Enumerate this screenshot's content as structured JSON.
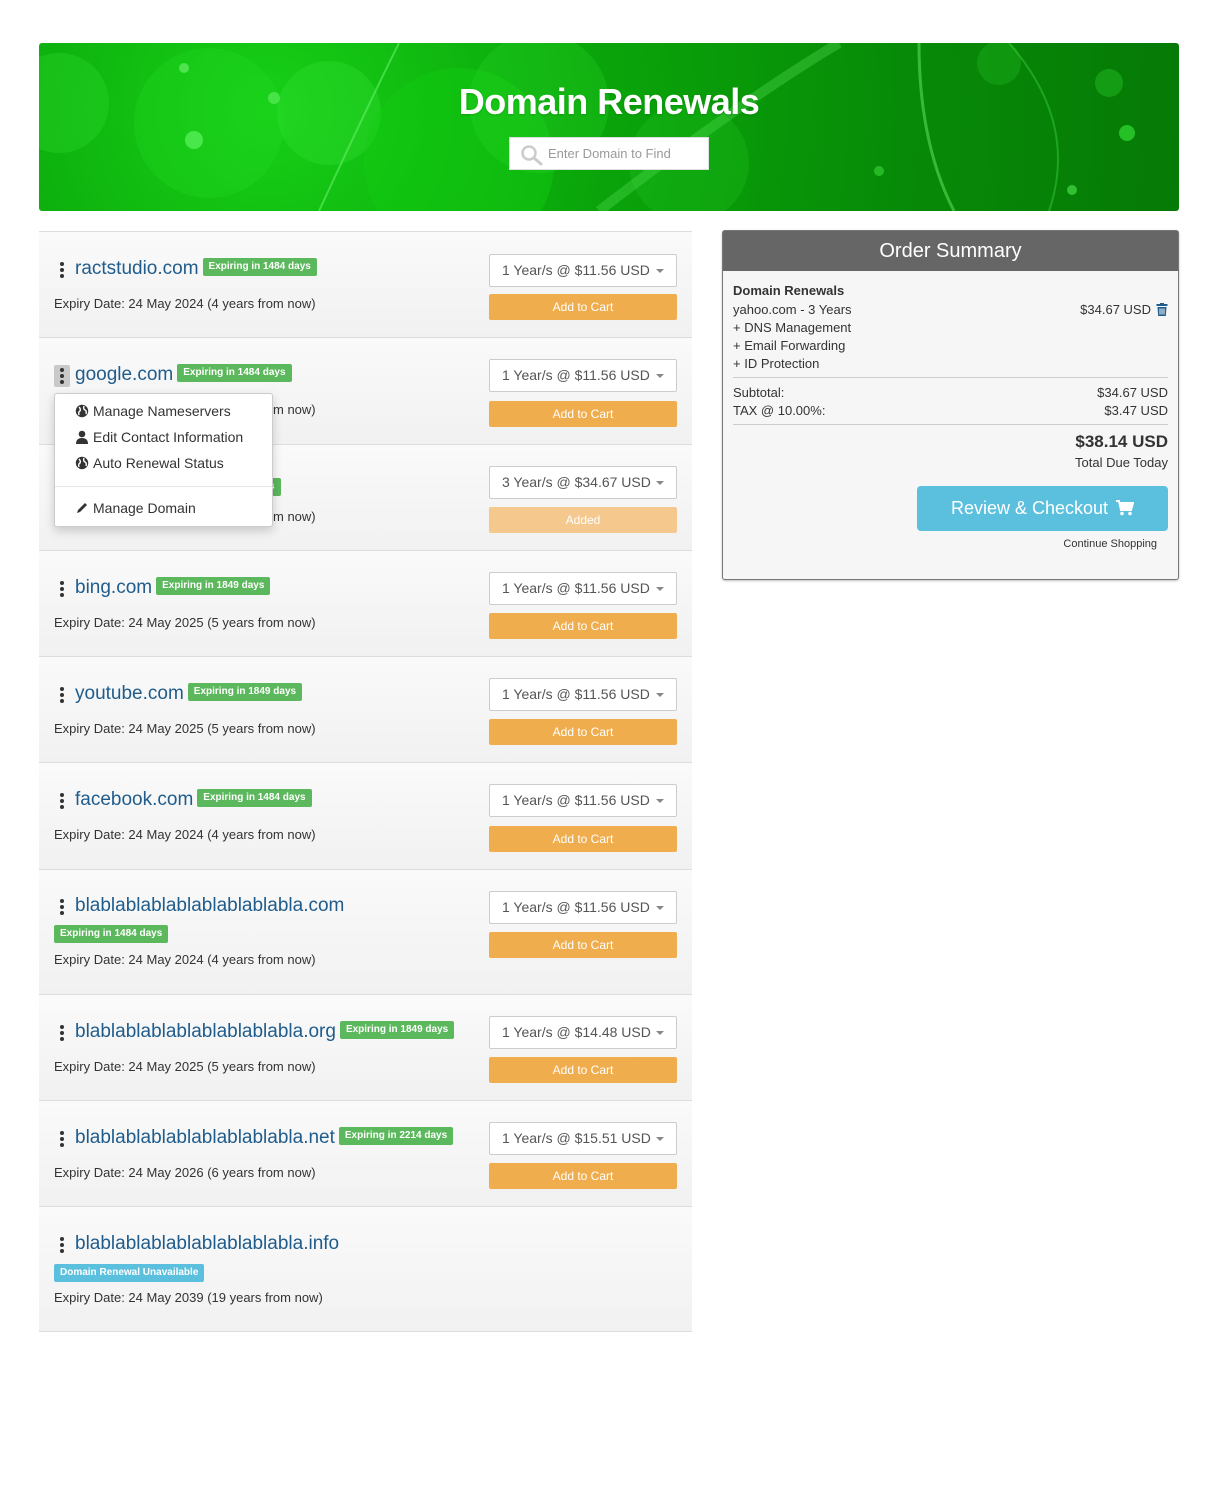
{
  "banner": {
    "title": "Domain Renewals",
    "search_placeholder": "Enter Domain to Find"
  },
  "domains": [
    {
      "name": "ractstudio.com",
      "badge": "Expiring in 1484 days",
      "expiry": "Expiry Date: 24 May 2024 (4 years from now)",
      "period": "1 Year/s @ $11.56 USD",
      "action": "Add to Cart"
    },
    {
      "name": "google.com",
      "badge": "Expiring in 1484 days",
      "expiry": "m now)",
      "period": "1 Year/s @ $11.56 USD",
      "action": "Add to Cart"
    },
    {
      "badge": "s",
      "expiry": "m now)",
      "period": "3 Year/s @ $34.67 USD",
      "action": "Added"
    },
    {
      "name": "bing.com",
      "badge": "Expiring in 1849 days",
      "expiry": "Expiry Date: 24 May 2025 (5 years from now)",
      "period": "1 Year/s @ $11.56 USD",
      "action": "Add to Cart"
    },
    {
      "name": "youtube.com",
      "badge": "Expiring in 1849 days",
      "expiry": "Expiry Date: 24 May 2025 (5 years from now)",
      "period": "1 Year/s @ $11.56 USD",
      "action": "Add to Cart"
    },
    {
      "name": "facebook.com",
      "badge": "Expiring in 1484 days",
      "expiry": "Expiry Date: 24 May 2024 (4 years from now)",
      "period": "1 Year/s @ $11.56 USD",
      "action": "Add to Cart"
    },
    {
      "name": "blablablablablablablablabla.com",
      "badge": "Expiring in 1484 days",
      "expiry": "Expiry Date: 24 May 2024 (4 years from now)",
      "period": "1 Year/s @ $11.56 USD",
      "action": "Add to Cart"
    },
    {
      "name": "blablablablablablablablabla.org",
      "badge": "Expiring in 1849 days",
      "expiry": "Expiry Date: 24 May 2025 (5 years from now)",
      "period": "1 Year/s @ $14.48 USD",
      "action": "Add to Cart"
    },
    {
      "name": "blablablablablablablablabla.net",
      "badge": "Expiring in 2214 days",
      "expiry": "Expiry Date: 24 May 2026 (6 years from now)",
      "period": "1 Year/s @ $15.51 USD",
      "action": "Add to Cart"
    },
    {
      "name": "blablablablablablablablabla.info",
      "badge": "Domain Renewal Unavailable",
      "expiry": "Expiry Date: 24 May 2039 (19 years from now)"
    }
  ],
  "menu": {
    "items": [
      "Manage Nameservers",
      "Edit Contact Information",
      "Auto Renewal Status",
      "Manage Domain"
    ],
    "icons": [
      "globe-icon",
      "user-icon",
      "globe-icon",
      "pencil-icon"
    ]
  },
  "summary": {
    "title": "Order Summary",
    "section": "Domain Renewals",
    "item": "yahoo.com - 3 Years",
    "item_price": "$34.67 USD",
    "addons": [
      "+ DNS Management",
      "+ Email Forwarding",
      "+ ID Protection"
    ],
    "subtotal_label": "Subtotal:",
    "subtotal_value": "$34.67 USD",
    "tax_label": "TAX @ 10.00%:",
    "tax_value": "$3.47 USD",
    "total": "$38.14 USD",
    "total_label": "Total Due Today",
    "checkout_label": "Review & Checkout",
    "continue_label": "Continue Shopping"
  },
  "colors": {
    "banner_green": "#0aa60a",
    "link_blue": "#1f5c8c",
    "badge_green": "#5cb85c",
    "badge_blue": "#5bc0de",
    "cart_orange": "#f0ad4e",
    "checkout_blue": "#5bc0de",
    "summary_header": "#666666"
  }
}
